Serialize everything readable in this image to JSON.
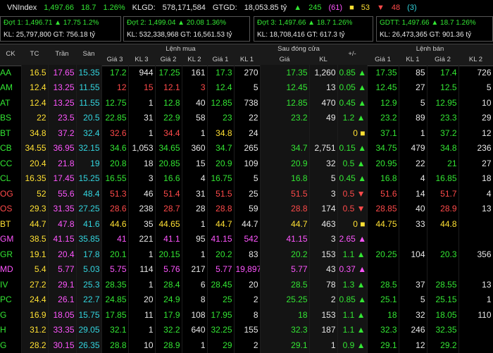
{
  "top_bar": {
    "index": "VNIndex",
    "value": "1,497.66",
    "change": "18.7",
    "pct": "1.26%",
    "klgd_label": "KLGD:",
    "klgd": "578,171,584",
    "gtgd_label": "GTGD:",
    "gtgd": "18,053.85 tỷ",
    "up": "245",
    "up_ceiling": "61",
    "same": "53",
    "down": "48",
    "down_floor": "3"
  },
  "sessions": [
    {
      "line1": "Đợt 1: 1,496.71 ▲ 17.75 1.2%",
      "line2": "KL: 25,797,800   GT: 756.18 tỷ"
    },
    {
      "line1": "Đợt 2: 1,499.04 ▲ 20.08 1.36%",
      "line2": "KL: 532,338,968   GT: 16,561.53 tỷ"
    },
    {
      "line1": "Đợt 3: 1,497.66 ▲ 18.7 1.26%",
      "line2": "KL: 18,708,416   GT: 617.3 tỷ"
    },
    {
      "line1": "GDTT: 1,497.66 ▲ 18.7 1.26%",
      "line2": "KL: 26,473,365   GT: 901.36 tỷ"
    }
  ],
  "headers": {
    "ck": "CK",
    "tc": "TC",
    "tran": "Trần",
    "san": "Sàn",
    "lenh_mua": "Lệnh mua",
    "sau_dong_cua": "Sau đóng cửa",
    "plus_minus": "+/-",
    "lenh_ban": "Lệnh bán",
    "gia3": "Giá 3",
    "kl3": "KL 3",
    "gia2": "Giá 2",
    "kl2": "KL 2",
    "gia1": "Giá 1",
    "kl1": "KL 1",
    "gia": "Giá",
    "kl": "KL"
  },
  "rows": [
    {
      "s": "AA",
      "tc": "16.5",
      "tr": "17.65",
      "sa": "15.35",
      "b3": "17.2",
      "v3": "944",
      "b2": "17.25",
      "v2": "161",
      "b1": "17.3",
      "v1": "270",
      "p": "17.35",
      "k": "1,260",
      "d": "0.85 ▲",
      "a1": "17.35",
      "w1": "85",
      "a2": "17.4",
      "w2": "726",
      "cb": "g"
    },
    {
      "s": "AM",
      "tc": "12.4",
      "tr": "13.25",
      "sa": "11.55",
      "b3": "12",
      "v3": "15",
      "b2": "12.1",
      "v2": "3",
      "b1": "12.4",
      "v1": "5",
      "p": "12.45",
      "k": "13",
      "d": "0.05 ▲",
      "a1": "12.45",
      "w1": "27",
      "a2": "12.5",
      "w2": "5",
      "cb": "rg"
    },
    {
      "s": "AT",
      "tc": "12.4",
      "tr": "13.25",
      "sa": "11.55",
      "b3": "12.75",
      "v3": "1",
      "b2": "12.8",
      "v2": "40",
      "b1": "12.85",
      "v1": "738",
      "p": "12.85",
      "k": "470",
      "d": "0.45 ▲",
      "a1": "12.9",
      "w1": "5",
      "a2": "12.95",
      "w2": "10",
      "cb": "g"
    },
    {
      "s": "BS",
      "tc": "22",
      "tr": "23.5",
      "sa": "20.5",
      "b3": "22.85",
      "v3": "31",
      "b2": "22.9",
      "v2": "58",
      "b1": "23",
      "v1": "22",
      "p": "23.2",
      "k": "49",
      "d": "1.2 ▲",
      "a1": "23.2",
      "w1": "89",
      "a2": "23.3",
      "w2": "29",
      "cb": "g"
    },
    {
      "s": "BT",
      "tc": "34.8",
      "tr": "37.2",
      "sa": "32.4",
      "b3": "32.6",
      "v3": "1",
      "b2": "34.4",
      "v2": "1",
      "b1": "34.8",
      "v1": "24",
      "p": "",
      "k": "",
      "d": "0 ■",
      "a1": "37.1",
      "w1": "1",
      "a2": "37.2",
      "w2": "12",
      "cb": "ry"
    },
    {
      "s": "CB",
      "tc": "34.55",
      "tr": "36.95",
      "sa": "32.15",
      "b3": "34.6",
      "v3": "1,053",
      "b2": "34.65",
      "v2": "360",
      "b1": "34.7",
      "v1": "265",
      "p": "34.7",
      "k": "2,751",
      "d": "0.15 ▲",
      "a1": "34.75",
      "w1": "479",
      "a2": "34.8",
      "w2": "236",
      "cb": "g"
    },
    {
      "s": "CC",
      "tc": "20.4",
      "tr": "21.8",
      "sa": "19",
      "b3": "20.8",
      "v3": "18",
      "b2": "20.85",
      "v2": "15",
      "b1": "20.9",
      "v1": "109",
      "p": "20.9",
      "k": "32",
      "d": "0.5 ▲",
      "a1": "20.95",
      "w1": "22",
      "a2": "21",
      "w2": "27",
      "cb": "g"
    },
    {
      "s": "CL",
      "tc": "16.35",
      "tr": "17.45",
      "sa": "15.25",
      "b3": "16.55",
      "v3": "3",
      "b2": "16.6",
      "v2": "4",
      "b1": "16.75",
      "v1": "5",
      "p": "16.8",
      "k": "5",
      "d": "0.45 ▲",
      "a1": "16.8",
      "w1": "4",
      "a2": "16.85",
      "w2": "18",
      "cb": "g"
    },
    {
      "s": "OG",
      "tc": "52",
      "tr": "55.6",
      "sa": "48.4",
      "b3": "51.3",
      "v3": "46",
      "b2": "51.4",
      "v2": "31",
      "b1": "51.5",
      "v1": "25",
      "p": "51.5",
      "k": "3",
      "d": "0.5 ▼",
      "a1": "51.6",
      "w1": "14",
      "a2": "51.7",
      "w2": "4",
      "cb": "r"
    },
    {
      "s": "OS",
      "tc": "29.3",
      "tr": "31.35",
      "sa": "27.25",
      "b3": "28.6",
      "v3": "238",
      "b2": "28.7",
      "v2": "28",
      "b1": "28.8",
      "v1": "59",
      "p": "28.8",
      "k": "174",
      "d": "0.5 ▼",
      "a1": "28.85",
      "w1": "40",
      "a2": "28.9",
      "w2": "13",
      "cb": "r"
    },
    {
      "s": "BT",
      "tc": "44.7",
      "tr": "47.8",
      "sa": "41.6",
      "b3": "44.6",
      "v3": "35",
      "b2": "44.65",
      "v2": "1",
      "b1": "44.7",
      "v1": "44.7",
      "p": "44.7",
      "k": "463",
      "d": "0 ■",
      "a1": "44.75",
      "w1": "33",
      "a2": "44.8",
      "w2": "",
      "cb": "y"
    },
    {
      "s": "GM",
      "tc": "38.5",
      "tr": "41.15",
      "sa": "35.85",
      "b3": "41",
      "v3": "221",
      "b2": "41.1",
      "v2": "95",
      "b1": "41.15",
      "v1": "542",
      "p": "41.15",
      "k": "3",
      "d": "2.65 ▲",
      "a1": "",
      "w1": "",
      "a2": "",
      "w2": "",
      "cb": "m"
    },
    {
      "s": "GR",
      "tc": "19.1",
      "tr": "20.4",
      "sa": "17.8",
      "b3": "20.1",
      "v3": "1",
      "b2": "20.15",
      "v2": "1",
      "b1": "20.2",
      "v1": "83",
      "p": "20.2",
      "k": "153",
      "d": "1.1 ▲",
      "a1": "20.25",
      "w1": "104",
      "a2": "20.3",
      "w2": "356",
      "cb": "g"
    },
    {
      "s": "MD",
      "tc": "5.4",
      "tr": "5.77",
      "sa": "5.03",
      "b3": "5.75",
      "v3": "114",
      "b2": "5.76",
      "v2": "217",
      "b1": "5.77",
      "v1": "19,897",
      "p": "5.77",
      "k": "43",
      "d": "0.37 ▲",
      "a1": "",
      "w1": "",
      "a2": "",
      "w2": "",
      "cb": "m"
    },
    {
      "s": "IV",
      "tc": "27.2",
      "tr": "29.1",
      "sa": "25.3",
      "b3": "28.35",
      "v3": "1",
      "b2": "28.4",
      "v2": "6",
      "b1": "28.45",
      "v1": "20",
      "p": "28.5",
      "k": "78",
      "d": "1.3 ▲",
      "a1": "28.5",
      "w1": "37",
      "a2": "28.55",
      "w2": "13",
      "cb": "g"
    },
    {
      "s": "PC",
      "tc": "24.4",
      "tr": "26.1",
      "sa": "22.7",
      "b3": "24.85",
      "v3": "20",
      "b2": "24.9",
      "v2": "8",
      "b1": "25",
      "v1": "2",
      "p": "25.25",
      "k": "2",
      "d": "0.85 ▲",
      "a1": "25.1",
      "w1": "5",
      "a2": "25.15",
      "w2": "1",
      "cb": "g"
    },
    {
      "s": "G",
      "tc": "16.9",
      "tr": "18.05",
      "sa": "15.75",
      "b3": "17.85",
      "v3": "11",
      "b2": "17.9",
      "v2": "108",
      "b1": "17.95",
      "v1": "8",
      "p": "18",
      "k": "153",
      "d": "1.1 ▲",
      "a1": "18",
      "w1": "32",
      "a2": "18.05",
      "w2": "110",
      "cb": "g"
    },
    {
      "s": "H",
      "tc": "31.2",
      "tr": "33.35",
      "sa": "29.05",
      "b3": "32.1",
      "v3": "1",
      "b2": "32.2",
      "v2": "640",
      "b1": "32.25",
      "v1": "155",
      "p": "32.3",
      "k": "187",
      "d": "1.1 ▲",
      "a1": "32.3",
      "w1": "246",
      "a2": "32.35",
      "w2": "",
      "cb": "g"
    },
    {
      "s": "G",
      "tc": "28.2",
      "tr": "30.15",
      "sa": "26.35",
      "b3": "28.8",
      "v3": "10",
      "b2": "28.9",
      "v2": "1",
      "b1": "29",
      "v1": "2",
      "p": "29.1",
      "k": "1",
      "d": "0.9 ▲",
      "a1": "29.1",
      "w1": "12",
      "a2": "29.2",
      "w2": "",
      "cb": "g"
    }
  ],
  "colors": {
    "up": "#33e633",
    "down": "#ff4a4a",
    "ref": "#ffe033",
    "ceiling": "#ff55ff",
    "floor": "#33d6e0"
  }
}
